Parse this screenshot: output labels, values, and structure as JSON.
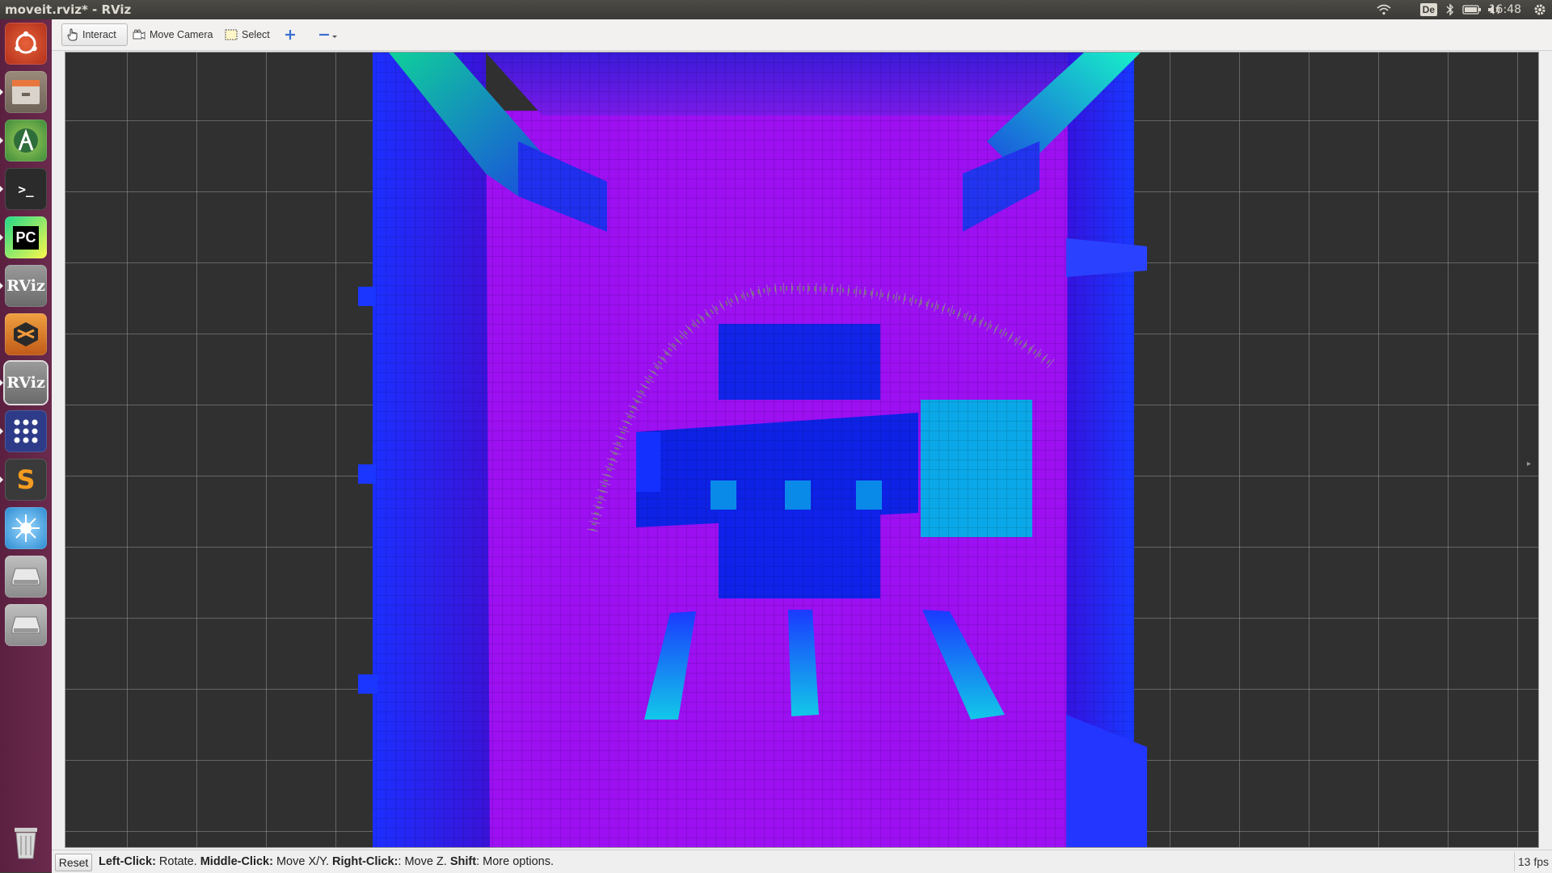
{
  "window": {
    "title": "moveit.rviz* - RViz"
  },
  "tray": {
    "lang": "De",
    "clock": "16:48",
    "icons": [
      "wifi-icon",
      "keyboard-layout-icon",
      "bluetooth-icon",
      "battery-icon",
      "volume-icon",
      "clock",
      "gear-icon"
    ]
  },
  "launcher": {
    "items": [
      {
        "name": "ubuntu-dash-icon"
      },
      {
        "name": "files-icon"
      },
      {
        "name": "android-studio-icon"
      },
      {
        "name": "terminal-icon",
        "label": ">_"
      },
      {
        "name": "pycharm-icon",
        "label": "PC"
      },
      {
        "name": "rviz-icon",
        "label": "RViz"
      },
      {
        "name": "sublime-merge-icon"
      },
      {
        "name": "rviz-icon-2",
        "label": "RViz"
      },
      {
        "name": "app-grid-icon"
      },
      {
        "name": "sublime-text-icon",
        "label": "S"
      },
      {
        "name": "gazebo-icon"
      },
      {
        "name": "drive-icon"
      },
      {
        "name": "drive-icon-2"
      },
      {
        "name": "trash-icon"
      }
    ]
  },
  "toolbar": {
    "interact_label": "Interact",
    "move_camera_label": "Move Camera",
    "select_label": "Select"
  },
  "statusbar": {
    "reset_label": "Reset",
    "hint_1_key": "Left-Click:",
    "hint_1_text": " Rotate. ",
    "hint_2_key": "Middle-Click:",
    "hint_2_text": " Move X/Y. ",
    "hint_3_key": "Right-Click:",
    "hint_3_text": ": Move Z. ",
    "hint_4_key": "Shift",
    "hint_4_text": ": More options.",
    "fps": "13 fps"
  },
  "colors": {
    "floor": "#9b0ef3",
    "wall": "#1a2cf0",
    "robot": "#0f22e6",
    "cyan": "#0aa8e8",
    "teal": "#11c8b0",
    "grid_bg": "#303030"
  }
}
